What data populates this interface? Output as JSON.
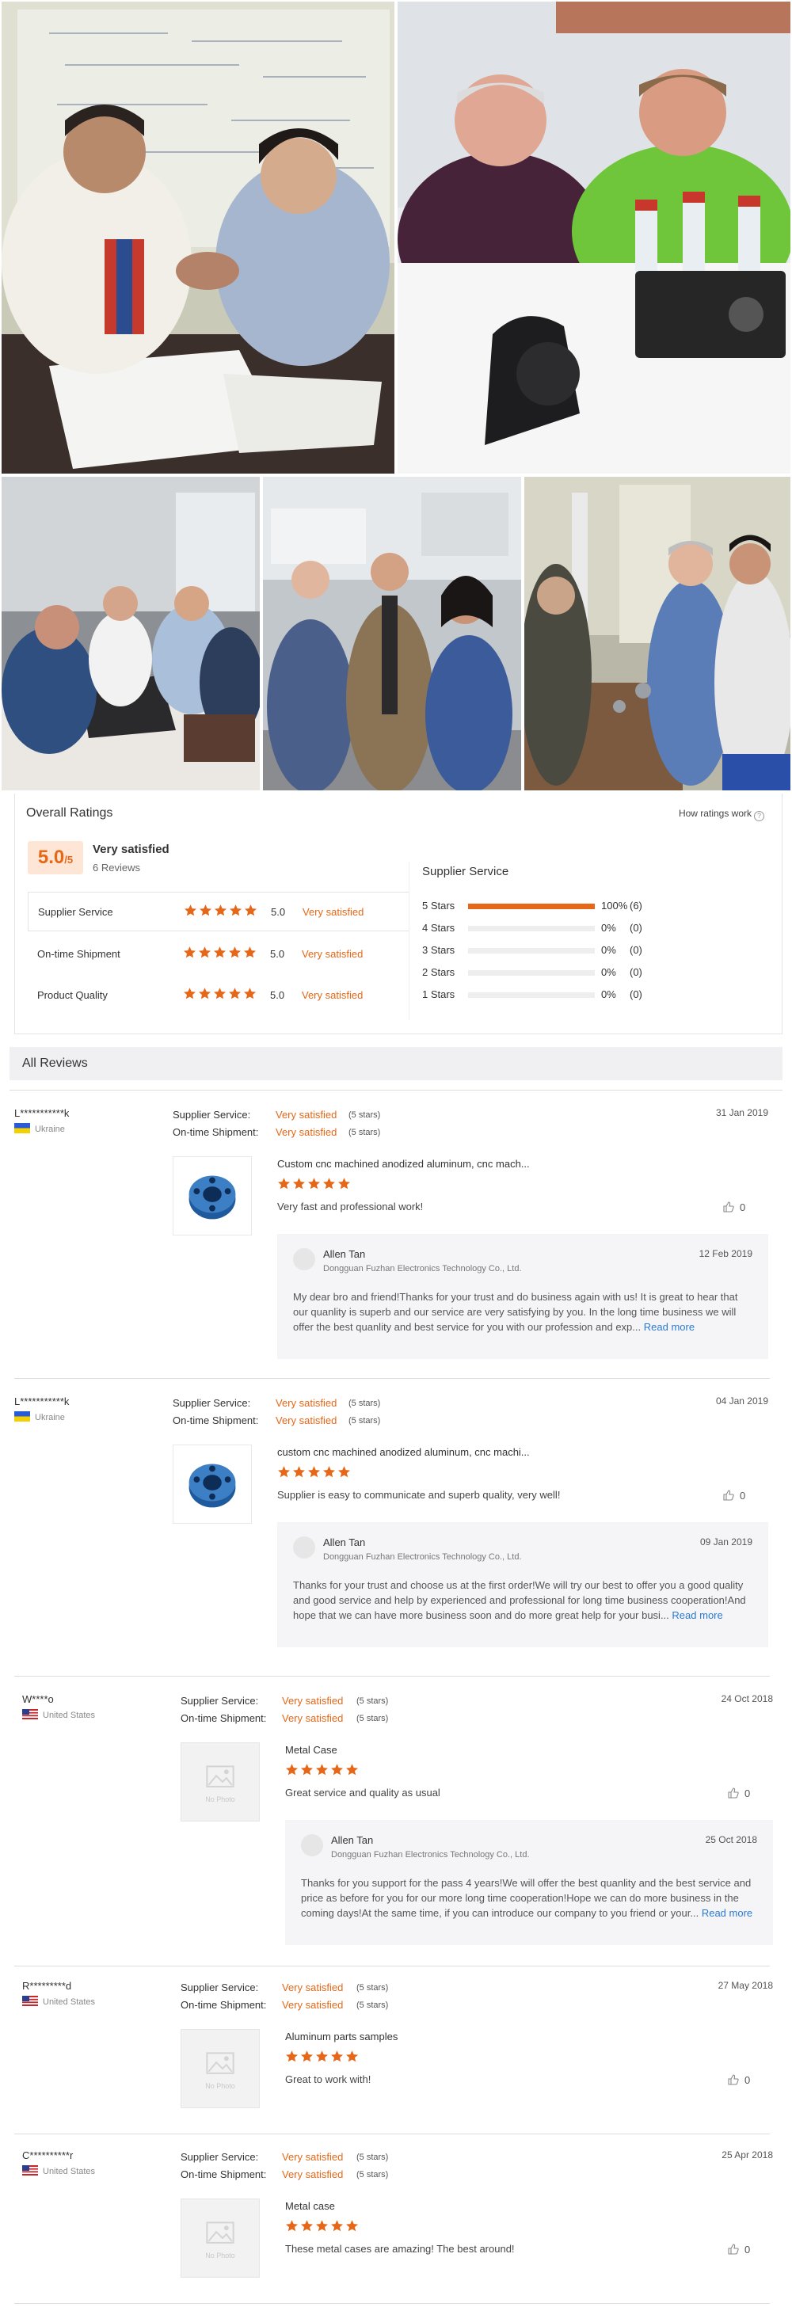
{
  "ratings": {
    "title": "Overall Ratings",
    "how_link": "How ratings work",
    "score_big": "5.0",
    "score_small": "/5",
    "overall_text": "Very satisfied",
    "review_count": "6 Reviews",
    "categories": [
      {
        "label": "Supplier Service",
        "value": "5.0",
        "desc": "Very satisfied",
        "stars": 5
      },
      {
        "label": "On-time Shipment",
        "value": "5.0",
        "desc": "Very satisfied",
        "stars": 5
      },
      {
        "label": "Product Quality",
        "value": "5.0",
        "desc": "Very satisfied",
        "stars": 5
      }
    ],
    "supplier_title": "Supplier Service",
    "distribution": [
      {
        "label": "5 Stars",
        "fraction": 1.0,
        "pct": "100%",
        "count": "(6)"
      },
      {
        "label": "4 Stars",
        "fraction": 0,
        "pct": "0%",
        "count": "(0)"
      },
      {
        "label": "3 Stars",
        "fraction": 0,
        "pct": "0%",
        "count": "(0)"
      },
      {
        "label": "2 Stars",
        "fraction": 0,
        "pct": "0%",
        "count": "(0)"
      },
      {
        "label": "1 Stars",
        "fraction": 0,
        "pct": "0%",
        "count": "(0)"
      }
    ]
  },
  "all_reviews_title": "All Reviews",
  "labels": {
    "supplier_service": "Supplier Service:",
    "ontime_shipment": "On-time Shipment:",
    "stars_5": "(5 stars)",
    "read_more": "Read more",
    "no_photo": "No Photo"
  },
  "reviews": [
    {
      "user": "L***********k",
      "country": "Ukraine",
      "service": "Very satisfied",
      "shipment": "Very satisfied",
      "date": "31 Jan 2019",
      "product": "Custom cnc machined anodized aluminum, cnc mach...",
      "stars": 5,
      "text": "Very fast and professional work!",
      "likes": "0",
      "reply": {
        "name": "Allen Tan",
        "company": "Dongguan Fuzhan Electronics Technology Co., Ltd.",
        "date": "12 Feb 2019",
        "body": "My dear bro and friend!Thanks for your trust and do business again with us!   It is great to hear that our quanlity is superb and our service are very satisfying by you. In the long time business we will offer the best quanlity and best service for you with our profession and exp..."
      }
    },
    {
      "user": "L***********k",
      "country": "Ukraine",
      "service": "Very satisfied",
      "shipment": "Very satisfied",
      "date": "04 Jan 2019",
      "product": "custom cnc machined anodized aluminum, cnc machi...",
      "stars": 5,
      "text": "Supplier is easy to communicate and superb quality, very well!",
      "likes": "0",
      "reply": {
        "name": "Allen Tan",
        "company": "Dongguan Fuzhan Electronics Technology Co., Ltd.",
        "date": "09 Jan 2019",
        "body": "Thanks for your trust and choose us at the first order!We will try our best to offer you a good quality and good service and help  by  experienced and professional for long time business cooperation!And hope that we can have more business soon and do more great help for your busi..."
      }
    },
    {
      "user": "W****o",
      "country": "United States",
      "service": "Very satisfied",
      "shipment": "Very satisfied",
      "date": "24 Oct 2018",
      "product": "Metal Case",
      "stars": 5,
      "text": "Great service and quality as usual",
      "likes": "0",
      "reply": {
        "name": "Allen Tan",
        "company": "Dongguan Fuzhan Electronics Technology Co., Ltd.",
        "date": "25 Oct 2018",
        "body": "Thanks for you support for the pass 4 years!We will offer the best quanlity and the best service and price as before for you for our more long time cooperation!Hope we can do more business in the coming days!At the same time, if you can introduce our company to you friend or your..."
      }
    },
    {
      "user": "R*********d",
      "country": "United States",
      "service": "Very satisfied",
      "shipment": "Very satisfied",
      "date": "27 May 2018",
      "product": "Aluminum parts samples",
      "stars": 5,
      "text": "Great to work with!",
      "likes": "0"
    },
    {
      "user": "C**********r",
      "country": "United States",
      "service": "Very satisfied",
      "shipment": "Very satisfied",
      "date": "25 Apr 2018",
      "product": "Metal case",
      "stars": 5,
      "text": "These metal cases are amazing! The best around!",
      "likes": "0"
    }
  ],
  "colors": {
    "accent": "#e56717",
    "link": "#2a7ad2"
  }
}
